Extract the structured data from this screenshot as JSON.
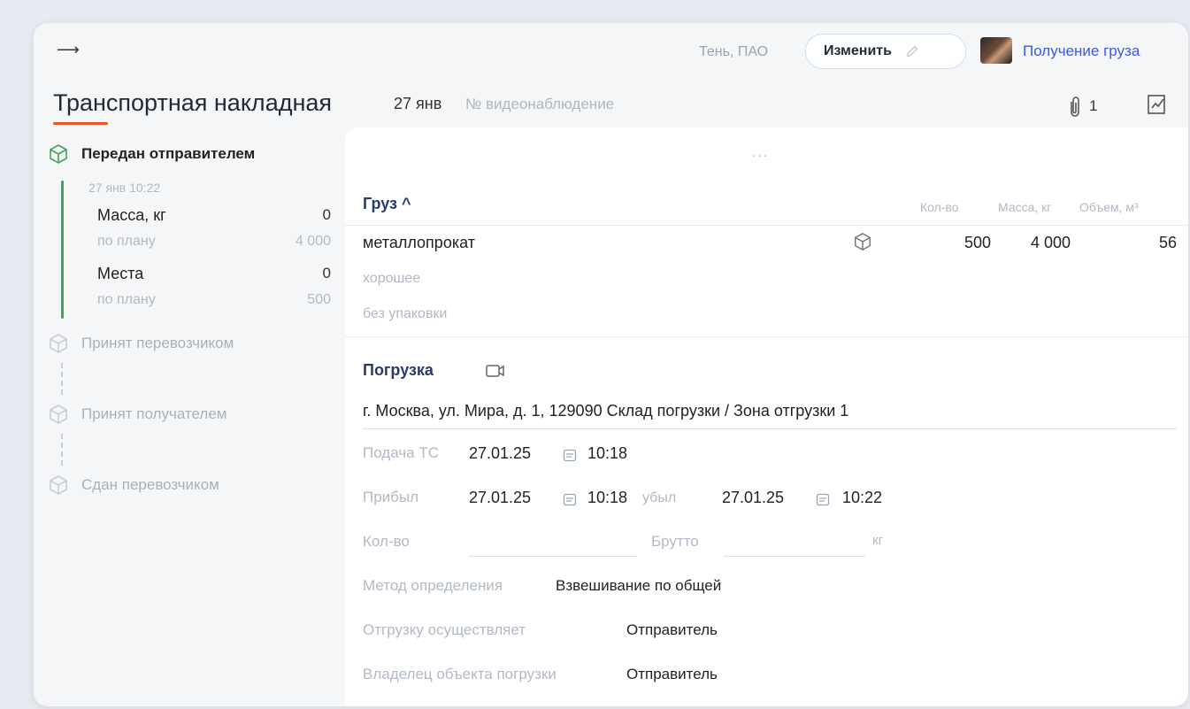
{
  "header": {
    "company": "Тень, ПАО",
    "edit_label": "Изменить",
    "receive_label": "Получение груза",
    "title": "Транспортная накладная",
    "date": "27 янв",
    "number_placeholder": "№ видеонаблюдение",
    "attachments_count": "1"
  },
  "timeline": {
    "steps": [
      {
        "label": "Передан отправителем",
        "status": "done"
      },
      {
        "label": "Принят перевозчиком",
        "status": "pending"
      },
      {
        "label": "Принят получателем",
        "status": "pending"
      },
      {
        "label": "Сдан перевозчиком",
        "status": "pending"
      }
    ],
    "datetime": "27 янв 10:22",
    "mass_label": "Масса, кг",
    "mass_value": "0",
    "mass_plan_label": "по плану",
    "mass_plan_value": "4 000",
    "places_label": "Места",
    "places_value": "0",
    "places_plan_label": "по плану",
    "places_plan_value": "500"
  },
  "cargo": {
    "menu_dots": "...",
    "section_title": "Груз ^",
    "columns": [
      "Кол-во",
      "Масса, кг",
      "Объем, м³"
    ],
    "item_name": "металлопрокат",
    "quantity": "500",
    "mass": "4 000",
    "volume": "56",
    "condition": "хорошее",
    "packaging": "без упаковки"
  },
  "loading": {
    "section_title": "Погрузка",
    "address": "г. Москва, ул. Мира, д. 1, 129090  Склад погрузки / Зона отгрузки 1",
    "vehicle_label": "Подача ТС",
    "vehicle_date": "27.01.25",
    "vehicle_time": "10:18",
    "arrived_label": "Прибыл",
    "arrived_date": "27.01.25",
    "arrived_time": "10:18",
    "departed_label": "убыл",
    "departed_date": "27.01.25",
    "departed_time": "10:22",
    "qty_label": "Кол-во",
    "gross_label": "Брутто",
    "gross_unit": "кг",
    "method_label": "Метод определения",
    "method_value": "Взвешивание по общей",
    "shipper_label": "Отгрузку осуществляет",
    "shipper_value": "Отправитель",
    "owner_label": "Владелец объекта погрузки",
    "owner_value": "Отправитель"
  }
}
